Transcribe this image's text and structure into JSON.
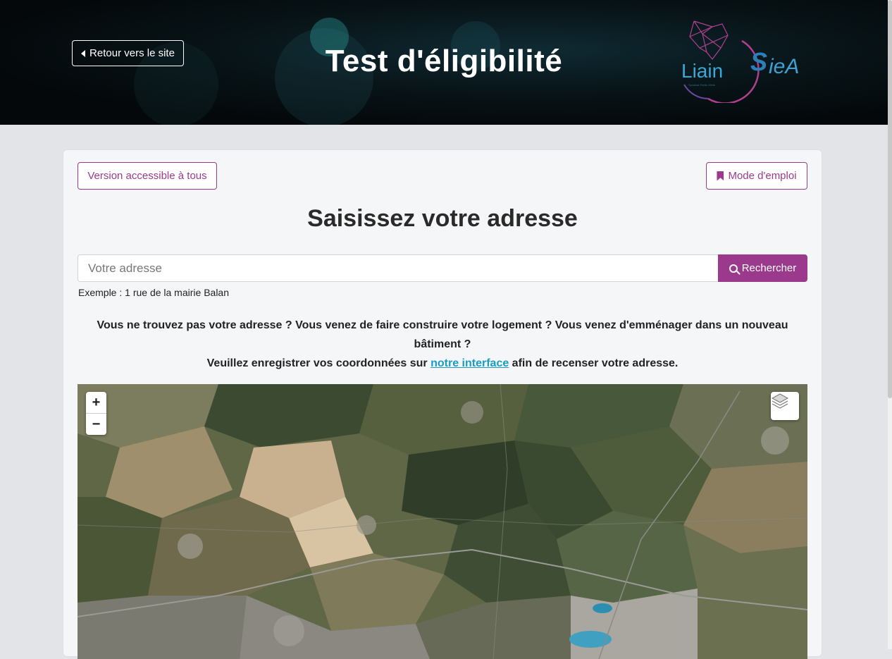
{
  "header": {
    "back_label": "Retour vers le site",
    "title": "Test d'éligibilité",
    "logo": {
      "name": "Liain",
      "partner": "SieA",
      "tagline": "Syndicat Public Mixte d'Énergie"
    }
  },
  "toolbar": {
    "accessible_label": "Version accessible à tous",
    "manual_label": "Mode d'emploi"
  },
  "search": {
    "title": "Saisissez votre adresse",
    "placeholder": "Votre adresse",
    "button_label": "Rechercher",
    "example": "Exemple : 1 rue de la mairie Balan"
  },
  "info": {
    "line1": "Vous ne trouvez pas votre adresse ? Vous venez de faire construire votre logement ? Vous venez d'emménager dans un nouveau bâtiment ?",
    "line2_before": "Veuillez enregistrer vos coordonnées sur ",
    "line2_link": "notre interface",
    "line2_after": " afin de recenser votre adresse."
  },
  "map": {
    "zoom_in": "+",
    "zoom_out": "−",
    "layers_icon": "layers-icon"
  },
  "colors": {
    "accent": "#9b3a8c",
    "link": "#1a9cc2",
    "header_bg": "#04080a"
  }
}
